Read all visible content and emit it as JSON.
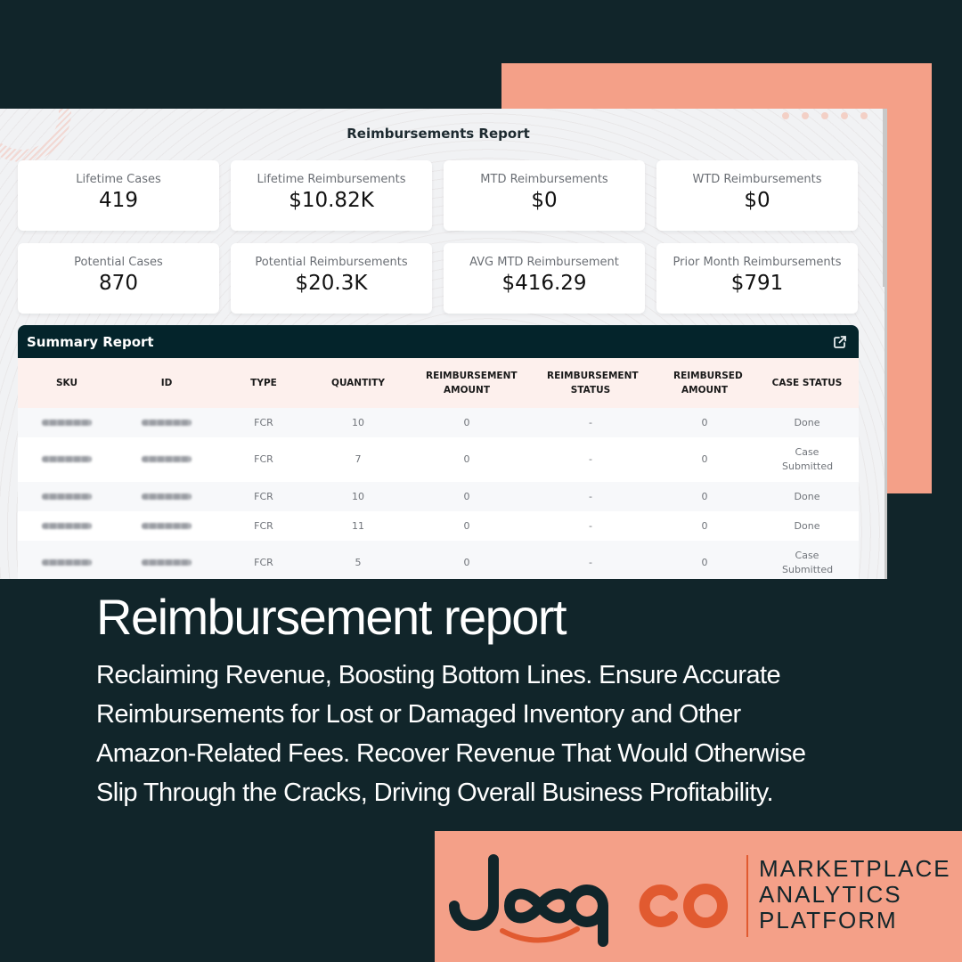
{
  "report": {
    "title": "Reimbursements Report",
    "stats": [
      {
        "label": "Lifetime Cases",
        "value": "419"
      },
      {
        "label": "Lifetime Reimbursements",
        "value": "$10.82K"
      },
      {
        "label": "MTD Reimbursements",
        "value": "$0"
      },
      {
        "label": "WTD Reimbursements",
        "value": "$0"
      },
      {
        "label": "Potential Cases",
        "value": "870"
      },
      {
        "label": "Potential Reimbursements",
        "value": "$20.3K"
      },
      {
        "label": "AVG MTD Reimbursement",
        "value": "$416.29"
      },
      {
        "label": "Prior Month Reimbursements",
        "value": "$791"
      }
    ]
  },
  "summary": {
    "title": "Summary Report",
    "open_icon": "external-link-icon",
    "columns": [
      "SKU",
      "ID",
      "TYPE",
      "QUANTITY",
      "REIMBURSEMENT AMOUNT",
      "REIMBURSEMENT STATUS",
      "REIMBURSED AMOUNT",
      "CASE STATUS"
    ],
    "rows": [
      {
        "sku": "######",
        "id": "######",
        "type": "FCR",
        "quantity": "10",
        "reimbursement_amount": "0",
        "reimbursement_status": "-",
        "reimbursed_amount": "0",
        "case_status": "Done"
      },
      {
        "sku": "######",
        "id": "######",
        "type": "FCR",
        "quantity": "7",
        "reimbursement_amount": "0",
        "reimbursement_status": "-",
        "reimbursed_amount": "0",
        "case_status": "Case Submitted"
      },
      {
        "sku": "######",
        "id": "######",
        "type": "FCR",
        "quantity": "10",
        "reimbursement_amount": "0",
        "reimbursement_status": "-",
        "reimbursed_amount": "0",
        "case_status": "Done"
      },
      {
        "sku": "######",
        "id": "######",
        "type": "FCR",
        "quantity": "11",
        "reimbursement_amount": "0",
        "reimbursement_status": "-",
        "reimbursed_amount": "0",
        "case_status": "Done"
      },
      {
        "sku": "######",
        "id": "######",
        "type": "FCR",
        "quantity": "5",
        "reimbursement_amount": "0",
        "reimbursement_status": "-",
        "reimbursed_amount": "0",
        "case_status": "Case Submitted"
      }
    ]
  },
  "marketing": {
    "headline": "Reimbursement report",
    "body": "Reclaiming Revenue, Boosting Bottom Lines. Ensure Accurate Reimbursements for Lost or Damaged Inventory and Other Amazon-Related Fees. Recover Revenue That Would Otherwise Slip Through the Cracks, Driving Overall Business Profitability."
  },
  "brand": {
    "name": "Joopco",
    "tagline_lines": [
      "MARKETPLACE",
      "ANALYTICS",
      "PLATFORM"
    ],
    "colors": {
      "dark": "#11252a",
      "salmon": "#f4a088",
      "orange": "#e15a30",
      "table_header": "#04242b"
    }
  }
}
